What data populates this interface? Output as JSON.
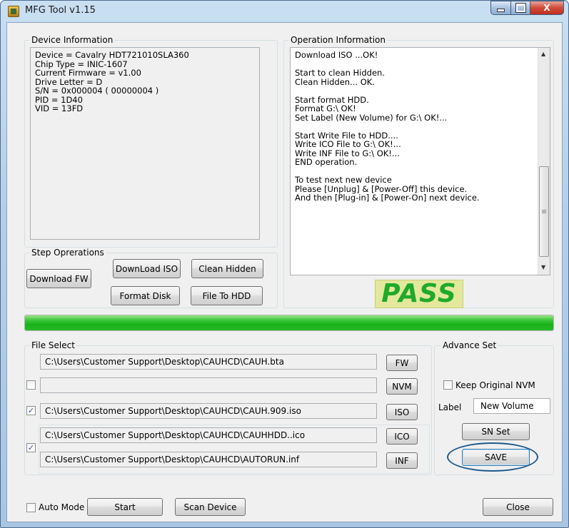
{
  "window": {
    "title": "MFG Tool v1.15",
    "icon": "app-icon",
    "caption_buttons": [
      "minimize-icon",
      "maximize-icon",
      "close-icon"
    ],
    "close_glyph": "X"
  },
  "device_info": {
    "group_label": "Device Information",
    "text": "Device = Cavalry HDT721010SLA360\nChip Type = INIC-1607\nCurrent Firmware = v1.00\nDrive Letter = D\nS/N = 0x000004 ( 00000004 )\nPID = 1D40\nVID = 13FD"
  },
  "operation_info": {
    "group_label": "Operation Information",
    "lines": [
      "Download ISO ...OK!",
      "",
      "Start to clean Hidden.",
      "Clean Hidden... OK.",
      "",
      "Start format HDD.",
      "Format G:\\ OK!",
      "Set Label (New Volume) for G:\\ OK!...",
      "",
      "Start Write File to HDD....",
      "Write ICO File to G:\\ OK!...",
      "Write INF File to G:\\ OK!...",
      "END operation.",
      "",
      "To test next new device",
      "Please [Unplug] & [Power-Off] this device.",
      "And then [Plug-in] & [Power-On] next device."
    ],
    "scroll_up_glyph": "▲",
    "scroll_down_glyph": "▼"
  },
  "step_operations": {
    "group_label": "Step Oprerations",
    "download_fw": "Download FW",
    "download_iso": "DownLoad ISO",
    "clean_hidden": "Clean Hidden",
    "format_disk": "Format Disk",
    "file_to_hdd": "File To HDD"
  },
  "result": {
    "text": "PASS",
    "color": "#1faa2a"
  },
  "progress": {
    "percent": 100,
    "color": "#19b319"
  },
  "file_select": {
    "group_label": "File Select",
    "rows": [
      {
        "path": "C:\\Users\\Customer Support\\Desktop\\CAUHCD\\CAUH.bta",
        "button": "FW"
      },
      {
        "path": "",
        "button": "NVM",
        "checked": false
      },
      {
        "path": "C:\\Users\\Customer Support\\Desktop\\CAUHCD\\CAUH.909.iso",
        "button": "ISO",
        "checked": true
      },
      {
        "path": "C:\\Users\\Customer Support\\Desktop\\CAUHCD\\CAUHHDD..ico",
        "button": "ICO"
      },
      {
        "path": "C:\\Users\\Customer Support\\Desktop\\CAUHCD\\AUTORUN.inf",
        "button": "INF"
      }
    ],
    "ico_inf_checked": true,
    "check_glyph": "✓"
  },
  "advance_set": {
    "group_label": "Advance Set",
    "keep_original_nvm": "Keep Original  NVM",
    "keep_original_checked": false,
    "label_caption": "Label",
    "label_value": "New Volume",
    "sn_set": "SN Set",
    "save": "SAVE",
    "highlight_color": "#1c5a8e"
  },
  "footer": {
    "auto_mode": "Auto Mode",
    "auto_mode_checked": false,
    "start": "Start",
    "scan_device": "Scan Device",
    "close": "Close"
  }
}
